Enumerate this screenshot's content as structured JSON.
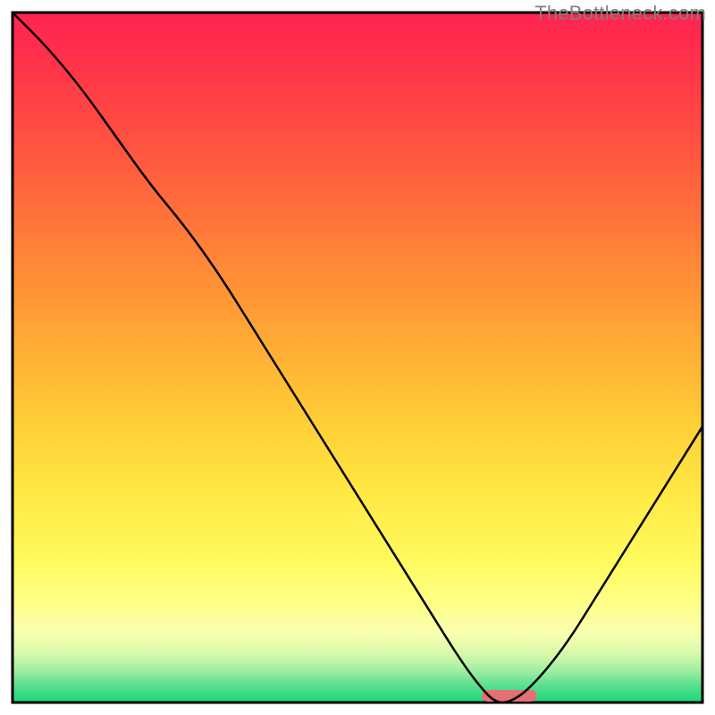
{
  "watermark": "TheBottleneck.com",
  "chart_data": {
    "type": "line",
    "title": "",
    "xlabel": "",
    "ylabel": "",
    "xlim": [
      0,
      100
    ],
    "ylim": [
      0,
      100
    ],
    "grid": false,
    "legend": false,
    "series": [
      {
        "name": "bottleneck-curve",
        "x": [
          0,
          5,
          10,
          15,
          20,
          25,
          30,
          35,
          40,
          45,
          50,
          55,
          60,
          65,
          68,
          70,
          72,
          75,
          80,
          85,
          90,
          95,
          100
        ],
        "values": [
          100,
          95,
          89,
          82,
          75,
          69,
          62,
          54,
          46,
          38,
          30,
          22,
          14,
          6,
          2,
          0,
          0,
          2,
          8,
          16,
          24,
          32,
          40
        ]
      }
    ],
    "optimal_marker": {
      "x_start": 68,
      "x_end": 76,
      "y": 0,
      "color": "#e56f73"
    },
    "gradient_stops": [
      {
        "offset": 0.0,
        "color": "#ff2450"
      },
      {
        "offset": 0.05,
        "color": "#ff2d4c"
      },
      {
        "offset": 0.12,
        "color": "#ff3f46"
      },
      {
        "offset": 0.2,
        "color": "#ff5540"
      },
      {
        "offset": 0.3,
        "color": "#ff743a"
      },
      {
        "offset": 0.4,
        "color": "#ff9336"
      },
      {
        "offset": 0.5,
        "color": "#ffb135"
      },
      {
        "offset": 0.6,
        "color": "#ffcf38"
      },
      {
        "offset": 0.7,
        "color": "#ffe945"
      },
      {
        "offset": 0.8,
        "color": "#fffb60"
      },
      {
        "offset": 0.86,
        "color": "#ffff8a"
      },
      {
        "offset": 0.9,
        "color": "#f9ffb0"
      },
      {
        "offset": 0.93,
        "color": "#d6f9aa"
      },
      {
        "offset": 0.955,
        "color": "#9ceea0"
      },
      {
        "offset": 0.975,
        "color": "#5adf8e"
      },
      {
        "offset": 1.0,
        "color": "#17d979"
      }
    ]
  }
}
